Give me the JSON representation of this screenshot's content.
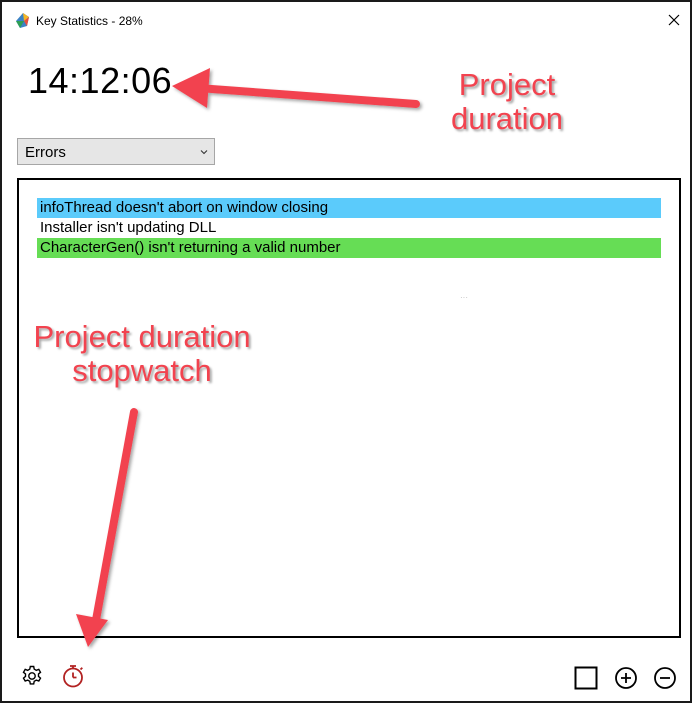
{
  "window": {
    "title": "Key Statistics - 28%",
    "close_icon": "close-icon",
    "app_icon": "app-logo-icon"
  },
  "timer": {
    "value": "14:12:06"
  },
  "filter": {
    "selected": "Errors",
    "chevron_icon": "chevron-down-icon"
  },
  "list": {
    "items": [
      {
        "text": "infoThread doesn't abort on window closing",
        "highlight": "#5bcbfb"
      },
      {
        "text": "Installer isn't updating DLL",
        "highlight": ""
      },
      {
        "text": "CharacterGen() isn't returning a valid number",
        "highlight": "#66dd55"
      }
    ]
  },
  "toolbar": {
    "left_icons": [
      "gear-icon",
      "stopwatch-icon"
    ],
    "right_icons": [
      "square-icon",
      "plus-circle-icon",
      "minus-circle-icon"
    ],
    "stopwatch_color": "#b22222"
  },
  "annotations": {
    "color": "#f2434f",
    "duration": {
      "line1": "Project",
      "line2": "duration"
    },
    "stopwatch": {
      "line1": "Project duration",
      "line2": "stopwatch"
    }
  }
}
